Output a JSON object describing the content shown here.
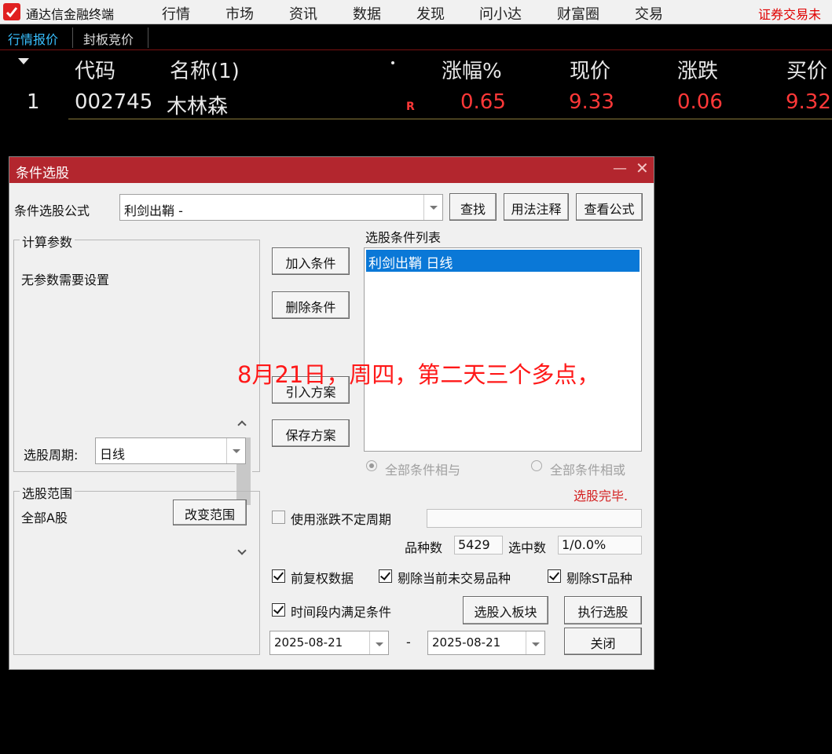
{
  "app": {
    "title": "通达信金融终端"
  },
  "menu": {
    "items": [
      "行情",
      "市场",
      "资讯",
      "数据",
      "发现",
      "问小达",
      "财富圈",
      "交易"
    ],
    "right_text": "证券交易未"
  },
  "tabs": [
    "行情报价",
    "封板竞价"
  ],
  "quote_table": {
    "headers": {
      "code": "代码",
      "name": "名称(1)",
      "change_pct": "涨幅%",
      "price": "现价",
      "change": "涨跌",
      "bid": "买价"
    },
    "rows": [
      {
        "index": "1",
        "code": "002745",
        "name": "木林森",
        "flag": "R",
        "change_pct": "0.65",
        "price": "9.33",
        "change": "0.06",
        "bid": "9.32"
      }
    ]
  },
  "dialog": {
    "title": "条件选股",
    "formula_label": "条件选股公式",
    "formula_value": "利剑出鞘  -",
    "buttons": {
      "find": "查找",
      "usage": "用法注释",
      "view_formula": "查看公式",
      "add_condition": "加入条件",
      "delete_condition": "删除条件",
      "import_plan": "引入方案",
      "save_plan": "保存方案",
      "change_range": "改变范围",
      "to_block": "选股入板块",
      "execute": "执行选股",
      "close": "关闭"
    },
    "params_group": {
      "label": "计算参数",
      "text": "无参数需要设置"
    },
    "period_label": "选股周期:",
    "period_value": "日线",
    "condition_list": {
      "label": "选股条件列表",
      "items": [
        "利剑出鞘  日线"
      ]
    },
    "logic": {
      "and_label": "全部条件相与",
      "or_label": "全部条件相或",
      "selected": "and"
    },
    "status": "选股完毕.",
    "range_group": {
      "label": "选股范围",
      "text": "全部A股"
    },
    "uncertain_period": {
      "label": "使用涨跌不定周期",
      "checked": false,
      "value": ""
    },
    "counts": {
      "total_label": "品种数",
      "total_value": "5429",
      "selected_label": "选中数",
      "selected_value": "1/0.0%"
    },
    "options": {
      "pre_adjust": {
        "label": "前复权数据",
        "checked": true
      },
      "exclude_untraded": {
        "label": "剔除当前未交易品种",
        "checked": true
      },
      "exclude_st": {
        "label": "剔除ST品种",
        "checked": true
      },
      "time_range": {
        "label": "时间段内满足条件",
        "checked": true
      }
    },
    "date_from": "2025-08-21",
    "date_sep": "-",
    "date_to": "2025-08-21"
  },
  "overlay_note": "8月21日，周四，第二天三个多点，",
  "colors": {
    "title_bar": "#b3262e",
    "price_red": "#ff3838",
    "tab_active": "#39c0ff",
    "selection": "#0a78d7"
  }
}
